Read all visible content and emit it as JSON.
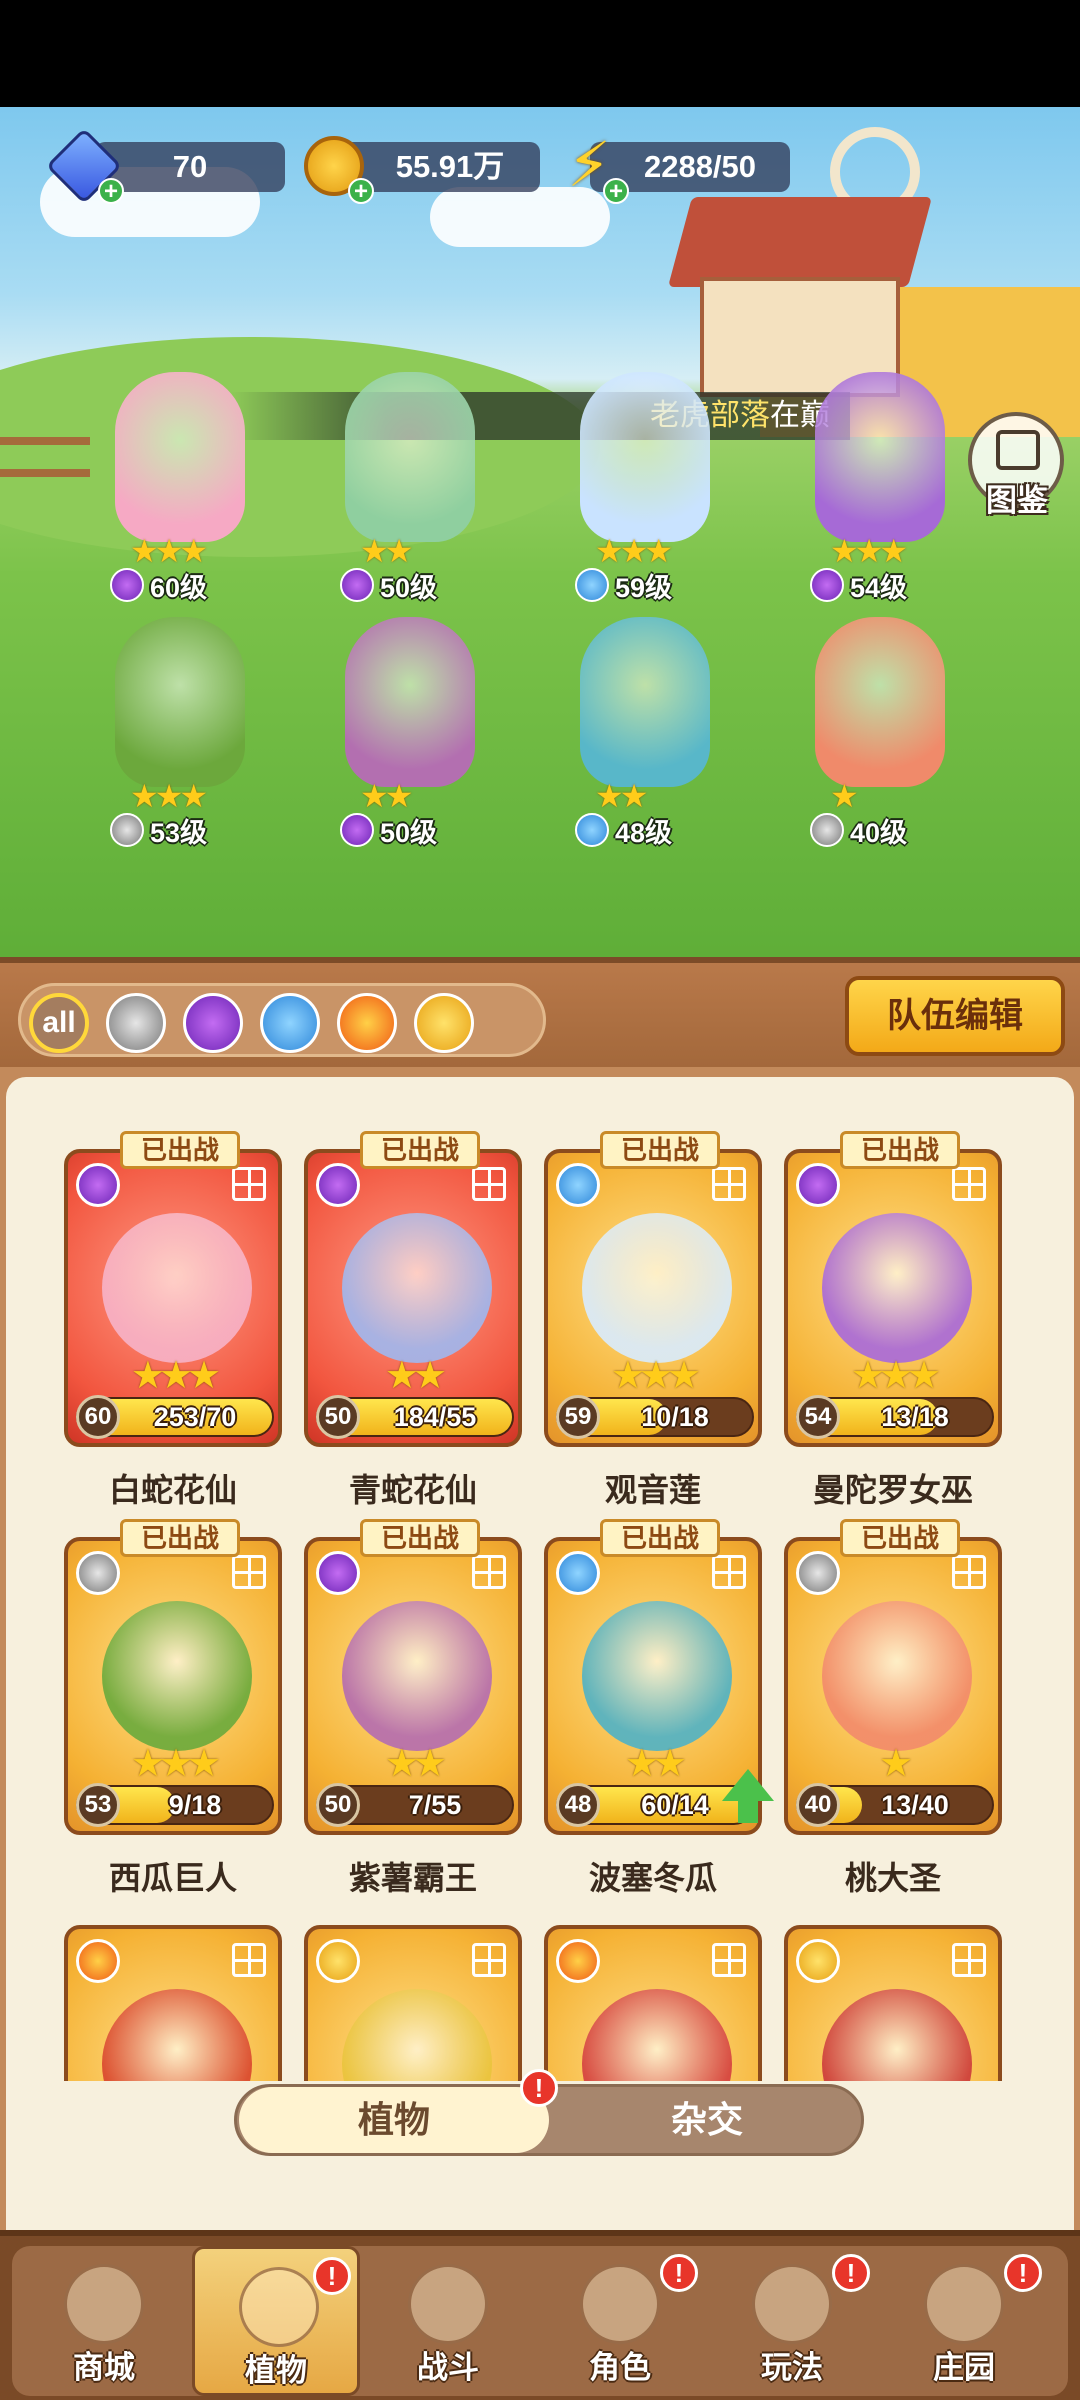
{
  "resources": {
    "gems": "70",
    "coins": "55.91万",
    "energy": "2288/50"
  },
  "banner": {
    "tribe": "老虎部落",
    "suffix": "在巅"
  },
  "codex_label": "图鉴",
  "lineup": [
    {
      "level": "60级",
      "stars": "★★★",
      "element": "potion",
      "color": "#f6a9c4"
    },
    {
      "level": "50级",
      "stars": "★★",
      "element": "potion",
      "color": "#8fcf9f"
    },
    {
      "level": "59级",
      "stars": "★★★",
      "element": "water",
      "color": "#c9e3ff"
    },
    {
      "level": "54级",
      "stars": "★★★",
      "element": "potion",
      "color": "#a66ad6"
    },
    {
      "level": "53级",
      "stars": "★★★",
      "element": "sword",
      "color": "#6ca83c"
    },
    {
      "level": "50级",
      "stars": "★★",
      "element": "potion",
      "color": "#b36fb0"
    },
    {
      "level": "48级",
      "stars": "★★",
      "element": "water",
      "color": "#58b7c9"
    },
    {
      "level": "40级",
      "stars": "★",
      "element": "sword",
      "color": "#f08a6a"
    }
  ],
  "filters": [
    "all",
    "sword",
    "potion",
    "water",
    "fire",
    "bolt"
  ],
  "filter_all_label": "all",
  "team_edit_label": "队伍编辑",
  "deployed_label": "已出战",
  "cards": [
    {
      "name": "白蛇花仙",
      "level": "60",
      "count": "253/70",
      "progress": 1.0,
      "stars": "★★★",
      "bg": "red",
      "element": "potion",
      "deployed": true,
      "upgrade": false,
      "color": "#f7b3c8"
    },
    {
      "name": "青蛇花仙",
      "level": "50",
      "count": "184/55",
      "progress": 1.0,
      "stars": "★★",
      "bg": "red",
      "element": "potion",
      "deployed": true,
      "upgrade": false,
      "color": "#9fb8f0"
    },
    {
      "name": "观音莲",
      "level": "59",
      "count": "10/18",
      "progress": 0.56,
      "stars": "★★★",
      "bg": "gold",
      "element": "water",
      "deployed": true,
      "upgrade": false,
      "color": "#d8ecff"
    },
    {
      "name": "曼陀罗女巫",
      "level": "54",
      "count": "13/18",
      "progress": 0.72,
      "stars": "★★★",
      "bg": "gold",
      "element": "potion",
      "deployed": true,
      "upgrade": false,
      "color": "#a869dc"
    },
    {
      "name": "西瓜巨人",
      "level": "53",
      "count": "9/18",
      "progress": 0.5,
      "stars": "★★★",
      "bg": "gold",
      "element": "sword",
      "deployed": true,
      "upgrade": false,
      "color": "#6aaa3c"
    },
    {
      "name": "紫薯霸王",
      "level": "50",
      "count": "7/55",
      "progress": 0.13,
      "stars": "★★",
      "bg": "gold",
      "element": "potion",
      "deployed": true,
      "upgrade": false,
      "color": "#b46cb1"
    },
    {
      "name": "波塞冬瓜",
      "level": "48",
      "count": "60/14",
      "progress": 1.0,
      "stars": "★★",
      "bg": "gold",
      "element": "water",
      "deployed": true,
      "upgrade": true,
      "color": "#4fb2c6"
    },
    {
      "name": "桃大圣",
      "level": "40",
      "count": "13/40",
      "progress": 0.33,
      "stars": "★",
      "bg": "gold",
      "element": "sword",
      "deployed": true,
      "upgrade": false,
      "color": "#f28a6b"
    },
    {
      "name": "",
      "level": "",
      "count": "",
      "progress": 0,
      "stars": "",
      "bg": "gold",
      "element": "fire",
      "deployed": false,
      "upgrade": false,
      "color": "#d9452d"
    },
    {
      "name": "",
      "level": "",
      "count": "",
      "progress": 0,
      "stars": "",
      "bg": "gold",
      "element": "bolt",
      "deployed": false,
      "upgrade": false,
      "color": "#e9c43c"
    },
    {
      "name": "",
      "level": "",
      "count": "",
      "progress": 0,
      "stars": "",
      "bg": "gold",
      "element": "fire",
      "deployed": false,
      "upgrade": false,
      "color": "#d43f3f"
    },
    {
      "name": "",
      "level": "",
      "count": "",
      "progress": 0,
      "stars": "",
      "bg": "gold",
      "element": "bolt",
      "deployed": false,
      "upgrade": false,
      "color": "#cc3a3a"
    }
  ],
  "toggle": {
    "active": "植物",
    "inactive": "杂交",
    "badge": "!"
  },
  "nav": [
    {
      "label": "商城",
      "badge": false,
      "active": false
    },
    {
      "label": "植物",
      "badge": true,
      "active": true
    },
    {
      "label": "战斗",
      "badge": false,
      "active": false
    },
    {
      "label": "角色",
      "badge": true,
      "active": false
    },
    {
      "label": "玩法",
      "badge": true,
      "active": false
    },
    {
      "label": "庄园",
      "badge": true,
      "active": false
    }
  ],
  "colors": {
    "accent": "#f3a918",
    "wood": "#a3683b",
    "panel": "#f7f0dd",
    "badge": "#e8352a"
  }
}
